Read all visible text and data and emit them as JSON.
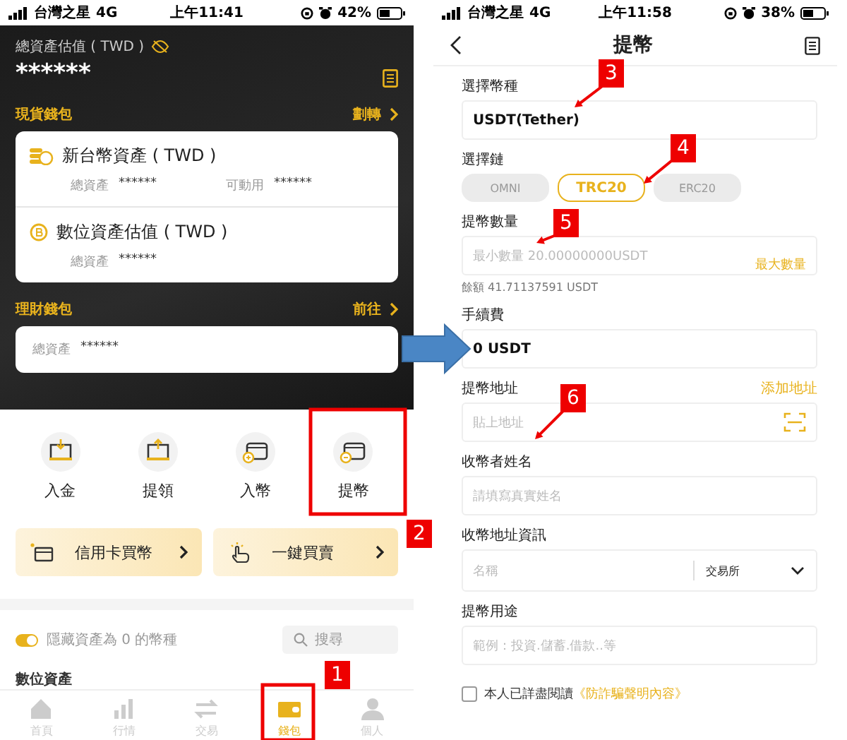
{
  "left_screen": {
    "status_bar": {
      "carrier": "台灣之星",
      "network": "4G",
      "time": "上午11:41",
      "battery": "42%"
    },
    "total_label": "總資產估值 ( TWD )",
    "total_value": "******",
    "spot_wallet": {
      "title": "現貨錢包",
      "link": "劃轉",
      "items": [
        {
          "kind": "fiat",
          "title": "新台幣資產 ( TWD )",
          "fields": [
            {
              "label": "總資產",
              "value": "******"
            },
            {
              "label": "可動用",
              "value": "******"
            }
          ]
        },
        {
          "kind": "crypto",
          "title": "數位資產估值 ( TWD )",
          "fields": [
            {
              "label": "總資產",
              "value": "******"
            }
          ]
        }
      ]
    },
    "finance_wallet": {
      "title": "理財錢包",
      "link": "前往",
      "fields": [
        {
          "label": "總資產",
          "value": "******"
        }
      ]
    },
    "actions": [
      {
        "kind": "deposit",
        "label": "入金"
      },
      {
        "kind": "withdraw",
        "label": "提領"
      },
      {
        "kind": "coin_in",
        "label": "入幣"
      },
      {
        "kind": "coin_out",
        "label": "提幣"
      }
    ],
    "promos": [
      {
        "kind": "card",
        "label": "信用卡買幣"
      },
      {
        "kind": "tap",
        "label": "一鍵買賣"
      }
    ],
    "hide_zero": {
      "label": "隱藏資產為 0 的幣種",
      "on": true
    },
    "search": {
      "placeholder": "搜尋"
    },
    "section_title": "數位資產",
    "tabs": [
      {
        "kind": "home",
        "label": "首頁",
        "selected": false
      },
      {
        "kind": "market",
        "label": "行情",
        "selected": false
      },
      {
        "kind": "trade",
        "label": "交易",
        "selected": false
      },
      {
        "kind": "wallet",
        "label": "錢包",
        "selected": true
      },
      {
        "kind": "profile",
        "label": "個人",
        "selected": false
      }
    ]
  },
  "right_screen": {
    "status_bar": {
      "carrier": "台灣之星",
      "network": "4G",
      "time": "上午11:58",
      "battery": "38%"
    },
    "title": "提幣",
    "fields": [
      {
        "kind": "text",
        "label": "選擇幣種",
        "value": "USDT(Tether)"
      },
      {
        "kind": "chips",
        "label": "選擇鏈",
        "options": [
          {
            "label": "OMNI",
            "selected": false
          },
          {
            "label": "TRC20",
            "selected": true
          },
          {
            "label": "ERC20",
            "selected": false
          }
        ]
      },
      {
        "kind": "amount",
        "label": "提幣數量",
        "placeholder": "最小數量 20.00000000USDT",
        "action": "最大數量",
        "note": "餘額 41.71137591 USDT"
      },
      {
        "kind": "text",
        "label": "手續費",
        "value": "0 USDT"
      },
      {
        "kind": "address",
        "label": "提幣地址",
        "link": "添加地址",
        "placeholder": "貼上地址"
      },
      {
        "kind": "input",
        "label": "收幣者姓名",
        "placeholder": "請填寫真實姓名"
      },
      {
        "kind": "select",
        "label": "收幣地址資訊",
        "placeholder": "名稱",
        "value": "交易所"
      },
      {
        "kind": "input",
        "label": "提幣用途",
        "placeholder": "範例：投資.儲蓄.借款..等"
      }
    ],
    "consent": {
      "checked": false,
      "text": "本人已詳盡閱讀",
      "link": "《防詐騙聲明內容》"
    }
  },
  "annotations": [
    {
      "number": "1"
    },
    {
      "number": "2"
    },
    {
      "number": "3"
    },
    {
      "number": "4"
    },
    {
      "number": "5"
    },
    {
      "number": "6"
    }
  ]
}
